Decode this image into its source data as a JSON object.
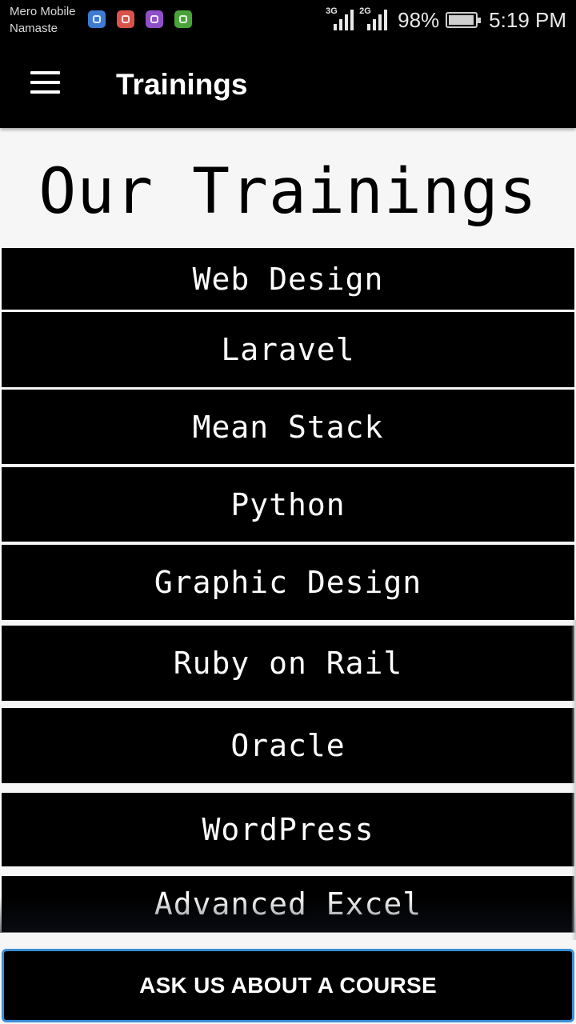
{
  "status_bar": {
    "carrier_line1": "Mero Mobile",
    "carrier_line2": "Namaste",
    "notification_icons": [
      {
        "name": "messenger-icon",
        "color": "#3d7bd1"
      },
      {
        "name": "mail-icon",
        "color": "#d9534a"
      },
      {
        "name": "gallery-icon",
        "color": "#8e4fc8"
      },
      {
        "name": "security-icon",
        "color": "#4aa33a"
      }
    ],
    "network1": "3G",
    "network2": "2G",
    "battery_percent": "98%",
    "battery_level": 0.98,
    "time": "5:19 PM"
  },
  "app_bar": {
    "title": "Trainings",
    "menu_icon": "hamburger-menu-icon"
  },
  "main": {
    "heading": "Our Trainings",
    "courses": [
      {
        "label": "Web Design"
      },
      {
        "label": "Laravel"
      },
      {
        "label": "Mean Stack"
      },
      {
        "label": "Python"
      },
      {
        "label": "Graphic Design"
      },
      {
        "label": "Ruby on Rail"
      },
      {
        "label": "Oracle"
      },
      {
        "label": "WordPress"
      },
      {
        "label": "Advanced Excel"
      }
    ]
  },
  "cta": {
    "label": "ASK US ABOUT A COURSE",
    "border_color": "#3a8fd4"
  }
}
